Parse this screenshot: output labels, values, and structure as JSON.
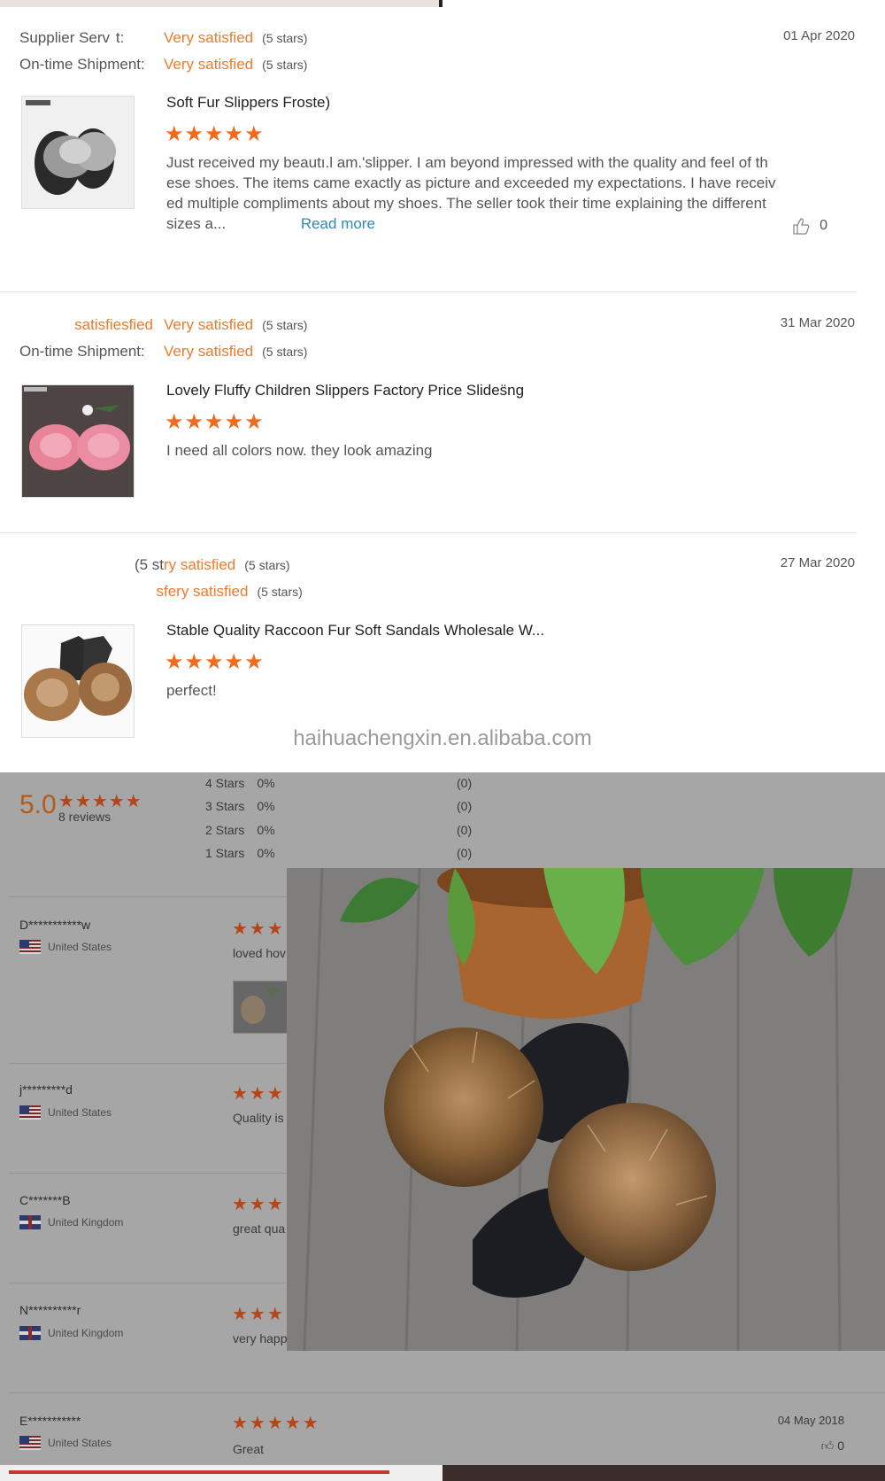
{
  "reviews": [
    {
      "supplier_label": "Supplier Serv  t:",
      "supplier_value": "Very satisfied",
      "supplier_stars": "(5 stars)",
      "shipment_label": "On-time Shipment:",
      "shipment_value": "Very satisfied",
      "shipment_stars": "(5 stars)",
      "date": "01 Apr 2020",
      "product_title": "Soft Fur Slippers Froste)",
      "stars": "★★★★★",
      "text": "Just received my beautı.l am.'slipper. I am beyond impressed with the quality and feel of th ese shoes. The items came exactly as picture and exceeded my expectations. I have receiv ed multiple compliments about my shoes. The seller took their time explaining the different sizes a...",
      "read_more": "Read more",
      "likes": "0"
    },
    {
      "supplier_label": "satisfiesfied",
      "supplier_value": "Very satisfied",
      "supplier_stars": "(5 stars)",
      "shipment_label": "On-time Shipment:",
      "shipment_value": "Very satisfied",
      "shipment_stars": "(5 stars)",
      "date": "31 Mar 2020",
      "product_title": "Lovely Fluffy Children Slippers Factory Price Slides̈ng",
      "stars": "★★★★★",
      "text": "I need all colors now. they look amazing"
    },
    {
      "supplier_label": "(5 st",
      "supplier_value": "ry satisfied",
      "supplier_stars": "(5 stars)",
      "shipment_label": "s",
      "shipment_value": "fery satisfied",
      "shipment_stars": "(5 stars)",
      "date": "27 Mar 2020",
      "product_title": "Stable Quality Raccoon Fur Soft Sandals Wholesale W...",
      "stars": "★★★★★",
      "text": "perfect!"
    }
  ],
  "watermark_url": "haihuachengxin.en.alibaba.com",
  "summary": {
    "score": "5.0",
    "stars": "★★★★★",
    "count": "8 reviews",
    "distribution": [
      {
        "label": "4 Stars",
        "pct": "0%",
        "count": "(0)"
      },
      {
        "label": "3 Stars",
        "pct": "0%",
        "count": "(0)"
      },
      {
        "label": "2 Stars",
        "pct": "0%",
        "count": "(0)"
      },
      {
        "label": "1 Stars",
        "pct": "0%",
        "count": "(0)"
      }
    ]
  },
  "buyer_reviews": [
    {
      "name": "D***********w",
      "country": "United States",
      "flag": "us",
      "stars": "★★★",
      "text": "loved hov"
    },
    {
      "name": "j*********d",
      "country": "United States",
      "flag": "us",
      "stars": "★★★",
      "text": "Quality is"
    },
    {
      "name": "C*******B",
      "country": "United Kingdom",
      "flag": "uk",
      "stars": "★★★",
      "text": "great qua"
    },
    {
      "name": "N**********r",
      "country": "United Kingdom",
      "flag": "uk",
      "stars": "★★★",
      "text": "very happ"
    },
    {
      "name": "E***********",
      "country": "United States",
      "flag": "us",
      "stars": "★★★★★",
      "text": "Great",
      "date": "04 May 2018",
      "likes": "0"
    }
  ],
  "colors": {
    "accent_orange": "#ee7a2c",
    "star_orange": "#f26a1b",
    "link_blue": "#2f88b7",
    "overlay_gray": "#a6a6a6"
  }
}
